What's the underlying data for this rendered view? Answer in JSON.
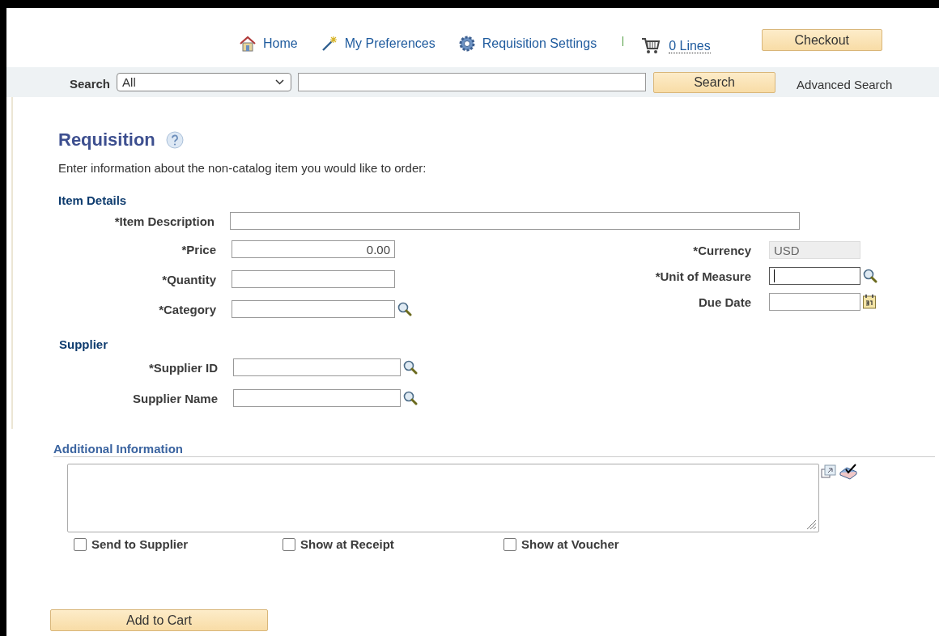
{
  "header": {
    "nav": [
      {
        "kind": "home",
        "label": "Home"
      },
      {
        "kind": "preferences",
        "label": "My Preferences"
      },
      {
        "kind": "settings",
        "label": "Requisition Settings"
      }
    ],
    "cart": {
      "label": "0 Lines"
    },
    "checkout_button": "Checkout"
  },
  "search_bar": {
    "label": "Search",
    "scope": "All",
    "button": "Search",
    "advanced_link": "Advanced Search"
  },
  "page": {
    "title": "Requisition",
    "intro": "Enter information about the non-catalog item you would like to order:"
  },
  "item_details": {
    "heading": "Item Details",
    "description": {
      "label": "*Item Description",
      "focused": false
    },
    "left_fields": [
      {
        "label": "*Price",
        "kind": "amount",
        "value": "0.00",
        "focused": false
      },
      {
        "label": "*Quantity",
        "kind": "text",
        "focused": false
      },
      {
        "label": "*Category",
        "kind": "lookup",
        "focused": false
      }
    ],
    "right_fields": [
      {
        "label": "*Currency",
        "kind": "readonly",
        "value": "USD",
        "focused": false
      },
      {
        "label": "*Unit of Measure",
        "kind": "lookup",
        "focused": true
      },
      {
        "label": "Due Date",
        "kind": "date",
        "focused": false
      }
    ]
  },
  "supplier": {
    "heading": "Supplier",
    "fields": [
      {
        "label": "*Supplier ID",
        "kind": "lookup",
        "focused": false
      },
      {
        "label": "Supplier Name",
        "kind": "lookup",
        "focused": false
      }
    ]
  },
  "additional_information": {
    "heading": "Additional Information",
    "options": [
      {
        "label": "Send to Supplier",
        "checked": false
      },
      {
        "label": "Show at Receipt",
        "checked": false
      },
      {
        "label": "Show at Voucher",
        "checked": false
      }
    ]
  },
  "add_to_cart_button": "Add to Cart"
}
